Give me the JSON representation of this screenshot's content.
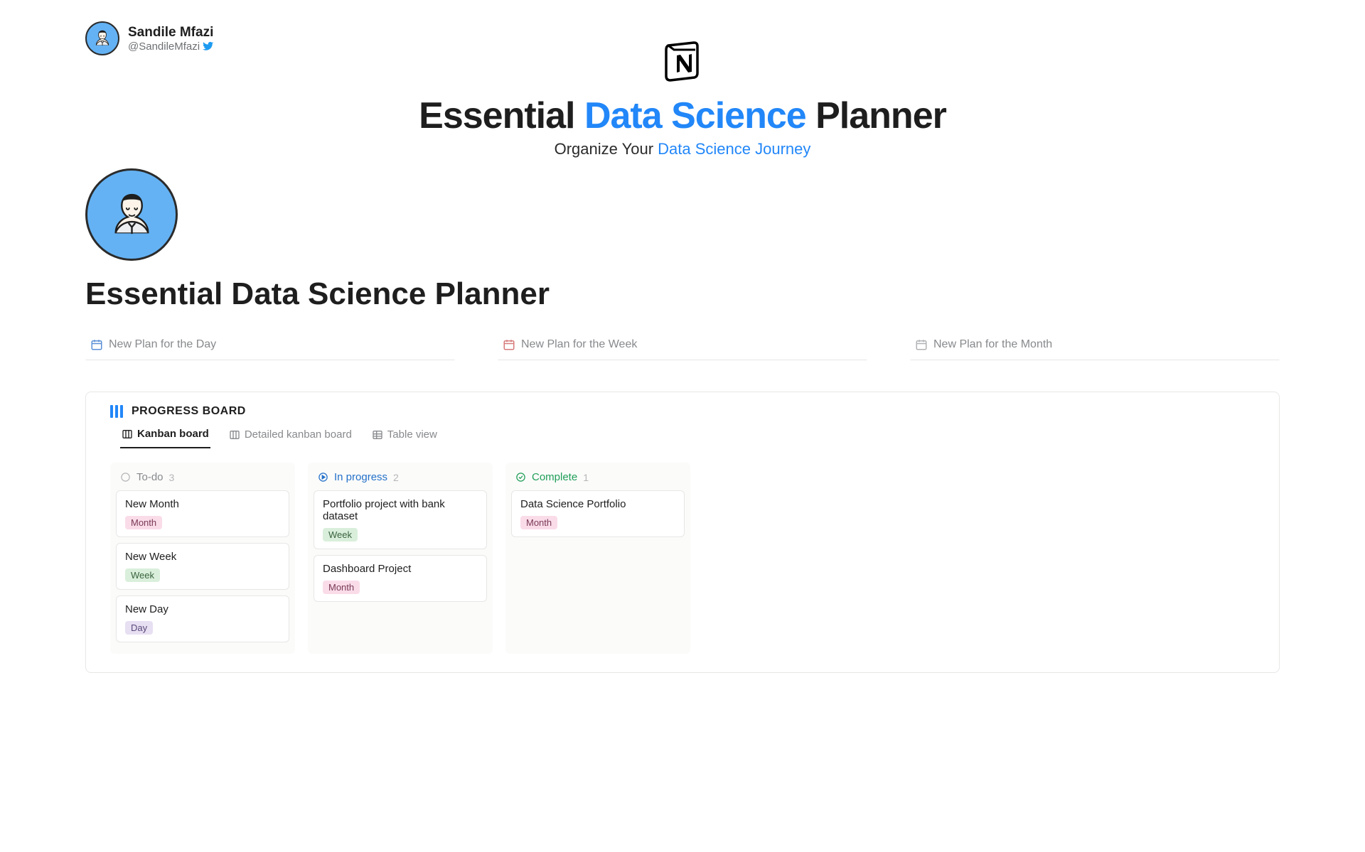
{
  "author": {
    "name": "Sandile Mfazi",
    "handle": "@SandileMfazi"
  },
  "hero": {
    "logo_letter": "N",
    "title_pre": "Essential ",
    "title_hl": "Data Science",
    "title_post": " Planner",
    "sub_pre": "Organize Your ",
    "sub_hl": "Data Science Journey"
  },
  "page_title": "Essential Data Science Planner",
  "plans": {
    "day": "New Plan for the Day",
    "week": "New Plan for the Week",
    "month": "New Plan for the Month"
  },
  "board": {
    "title": "PROGRESS BOARD",
    "tabs": {
      "kanban": "Kanban board",
      "detailed": "Detailed kanban board",
      "table": "Table view"
    },
    "columns": {
      "todo": {
        "name": "To-do",
        "count": "3",
        "cards": [
          {
            "title": "New Month",
            "tag": "Month",
            "tag_cls": "tag-month"
          },
          {
            "title": "New Week",
            "tag": "Week",
            "tag_cls": "tag-week"
          },
          {
            "title": "New Day",
            "tag": "Day",
            "tag_cls": "tag-day"
          }
        ]
      },
      "progress": {
        "name": "In progress",
        "count": "2",
        "cards": [
          {
            "title": "Portfolio project with bank dataset",
            "tag": "Week",
            "tag_cls": "tag-week"
          },
          {
            "title": "Dashboard Project",
            "tag": "Month",
            "tag_cls": "tag-month"
          }
        ]
      },
      "complete": {
        "name": "Complete",
        "count": "1",
        "cards": [
          {
            "title": "Data Science Portfolio",
            "tag": "Month",
            "tag_cls": "tag-month"
          }
        ]
      }
    }
  }
}
